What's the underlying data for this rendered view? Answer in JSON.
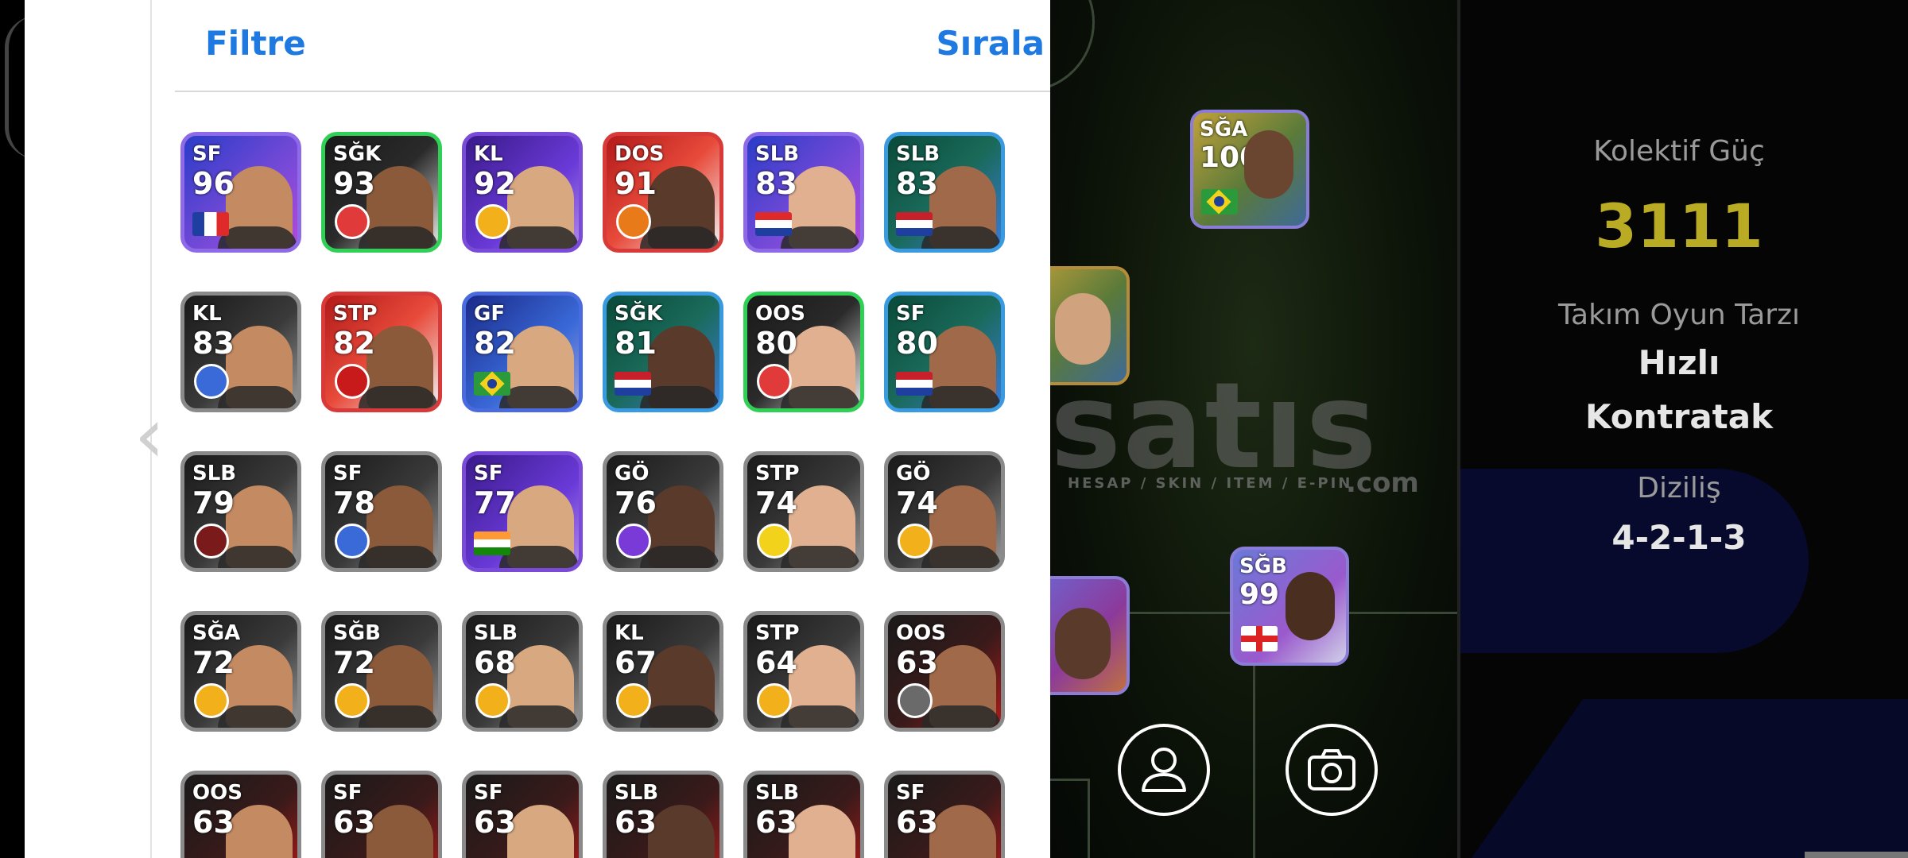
{
  "header": {
    "filter_label": "Filtre",
    "sort_label": "Sırala"
  },
  "players": [
    {
      "pos": "SF",
      "rating": "96",
      "style": "purple",
      "flag": "france"
    },
    {
      "pos": "SĞK",
      "rating": "93",
      "style": "green",
      "badge": "red"
    },
    {
      "pos": "KL",
      "rating": "92",
      "style": "violet",
      "badge": "galatasaray"
    },
    {
      "pos": "DOS",
      "rating": "91",
      "style": "red",
      "badge": "orange"
    },
    {
      "pos": "SLB",
      "rating": "83",
      "style": "purple",
      "flag": "croatia"
    },
    {
      "pos": "SLB",
      "rating": "83",
      "style": "teal",
      "flag": "netherlands"
    },
    {
      "pos": "KL",
      "rating": "83",
      "style": "dark",
      "badge": "blue"
    },
    {
      "pos": "STP",
      "rating": "82",
      "style": "red",
      "badge": "milan"
    },
    {
      "pos": "GF",
      "rating": "82",
      "style": "blue",
      "flag": "brazil"
    },
    {
      "pos": "SĞK",
      "rating": "81",
      "style": "teal",
      "flag": "netherlands"
    },
    {
      "pos": "OOS",
      "rating": "80",
      "style": "green",
      "badge": "red"
    },
    {
      "pos": "SF",
      "rating": "80",
      "style": "teal",
      "flag": "netherlands"
    },
    {
      "pos": "SLB",
      "rating": "79",
      "style": "dark",
      "badge": "darkred"
    },
    {
      "pos": "SF",
      "rating": "78",
      "style": "dark",
      "badge": "blue"
    },
    {
      "pos": "SF",
      "rating": "77",
      "style": "violet",
      "flag": "india"
    },
    {
      "pos": "GÖ",
      "rating": "76",
      "style": "dark",
      "badge": "purple"
    },
    {
      "pos": "STP",
      "rating": "74",
      "style": "dark",
      "badge": "yellow"
    },
    {
      "pos": "GÖ",
      "rating": "74",
      "style": "dark",
      "badge": "galatasaray"
    },
    {
      "pos": "SĞA",
      "rating": "72",
      "style": "dark",
      "badge": "galatasaray"
    },
    {
      "pos": "SĞB",
      "rating": "72",
      "style": "dark",
      "badge": "galatasaray"
    },
    {
      "pos": "SLB",
      "rating": "68",
      "style": "dark",
      "badge": "galatasaray"
    },
    {
      "pos": "KL",
      "rating": "67",
      "style": "dark",
      "badge": "galatasaray"
    },
    {
      "pos": "STP",
      "rating": "64",
      "style": "dark",
      "badge": "galatasaray"
    },
    {
      "pos": "OOS",
      "rating": "63",
      "style": "darkred",
      "badge": "grey"
    },
    {
      "pos": "OOS",
      "rating": "63",
      "style": "darkred"
    },
    {
      "pos": "SF",
      "rating": "63",
      "style": "darkred"
    },
    {
      "pos": "SF",
      "rating": "63",
      "style": "darkred"
    },
    {
      "pos": "SLB",
      "rating": "63",
      "style": "darkred"
    },
    {
      "pos": "SLB",
      "rating": "63",
      "style": "darkred"
    },
    {
      "pos": "SF",
      "rating": "63",
      "style": "darkred"
    }
  ],
  "field": {
    "watermark_logo": "satıs",
    "watermark_tagline": "HESAP / SKIN / ITEM / E-PIN",
    "watermark_com": ".com",
    "cards": [
      {
        "pos": "SĞA",
        "rating": "100",
        "flag": "brazil"
      },
      {
        "pos": "SĞB",
        "rating": "99",
        "flag": "england"
      }
    ]
  },
  "sidebar": {
    "power_label": "Kolektif Güç",
    "power_value": "3111",
    "style_label": "Takım Oyun Tarzı",
    "style_value_1": "Hızlı",
    "style_value_2": "Kontratak",
    "formation_label": "Diziliş",
    "formation_value": "4-2-1-3"
  },
  "colors": {
    "accent": "#1e7ae0",
    "power": "#b9ac24"
  }
}
